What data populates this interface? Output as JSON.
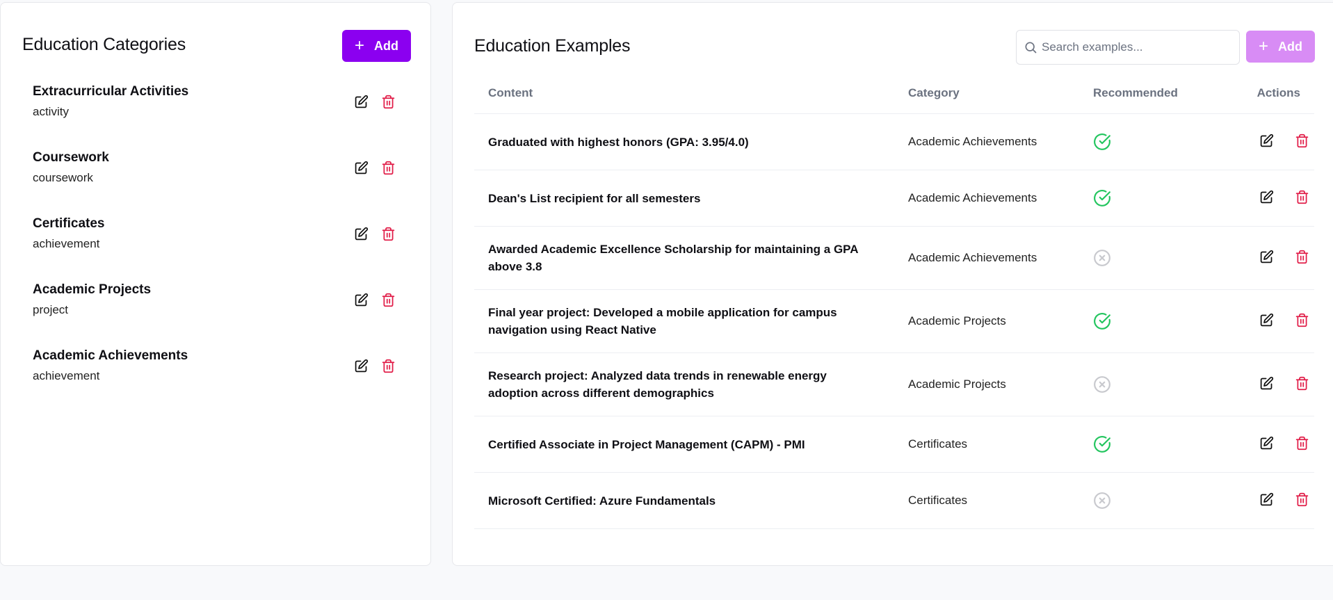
{
  "categories_panel": {
    "title": "Education Categories",
    "add_label": "Add",
    "items": [
      {
        "name": "Extracurricular Activities",
        "type": "activity"
      },
      {
        "name": "Coursework",
        "type": "coursework"
      },
      {
        "name": "Certificates",
        "type": "achievement"
      },
      {
        "name": "Academic Projects",
        "type": "project"
      },
      {
        "name": "Academic Achievements",
        "type": "achievement"
      }
    ]
  },
  "examples_panel": {
    "title": "Education Examples",
    "search_placeholder": "Search examples...",
    "add_label": "Add",
    "columns": [
      "Content",
      "Category",
      "Recommended",
      "Actions"
    ],
    "rows": [
      {
        "content": "Graduated with highest honors (GPA: 3.95/4.0)",
        "category": "Academic Achievements",
        "recommended": true
      },
      {
        "content": "Dean's List recipient for all semesters",
        "category": "Academic Achievements",
        "recommended": true
      },
      {
        "content": "Awarded Academic Excellence Scholarship for maintaining a GPA above 3.8",
        "category": "Academic Achievements",
        "recommended": false
      },
      {
        "content": "Final year project: Developed a mobile application for campus navigation using React Native",
        "category": "Academic Projects",
        "recommended": true
      },
      {
        "content": "Research project: Analyzed data trends in renewable energy adoption across different demographics",
        "category": "Academic Projects",
        "recommended": false
      },
      {
        "content": "Certified Associate in Project Management (CAPM) - PMI",
        "category": "Certificates",
        "recommended": true
      },
      {
        "content": "Microsoft Certified: Azure Fundamentals",
        "category": "Certificates",
        "recommended": false
      }
    ]
  },
  "colors": {
    "primary": "#8b00f0",
    "primary_disabled": "#d88cf5",
    "danger": "#e11d48",
    "success": "#22c55e",
    "muted": "#c8c9ce"
  },
  "icons": {
    "edit": "edit-icon",
    "delete": "trash-icon",
    "recommended_yes": "check-circle-icon",
    "recommended_no": "x-circle-icon",
    "search": "search-icon",
    "add": "plus-icon"
  }
}
